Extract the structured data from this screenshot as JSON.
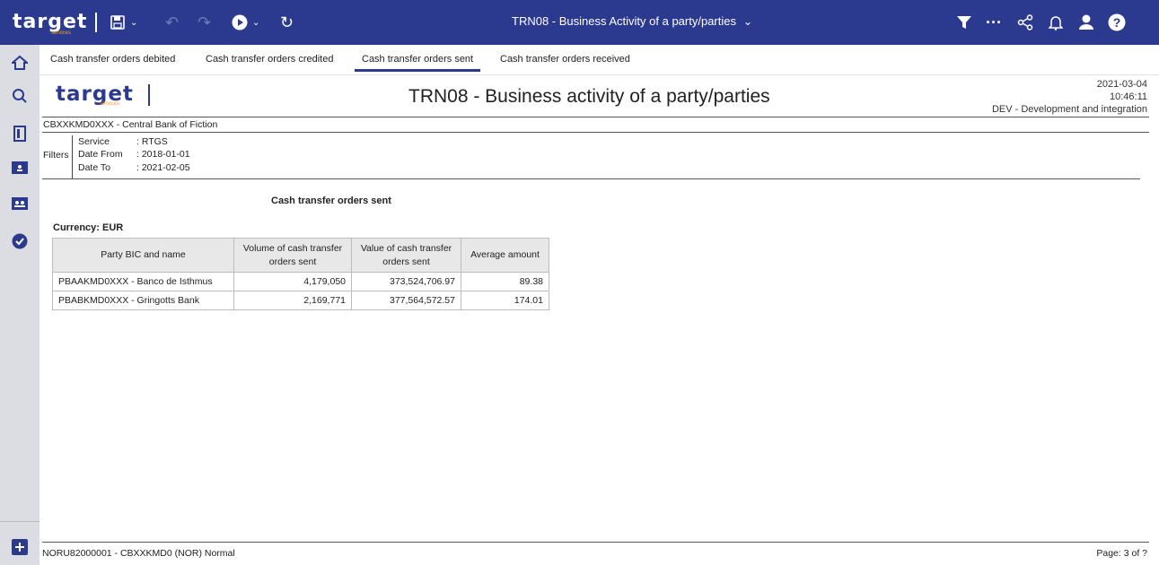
{
  "app": {
    "logo_text": "target",
    "logo_sub": "services",
    "report_title_bar": "TRN08 - Business Activity of a party/parties"
  },
  "tabs": [
    {
      "label": "Cash transfer orders debited"
    },
    {
      "label": "Cash transfer orders credited"
    },
    {
      "label": "Cash transfer orders sent",
      "active": true
    },
    {
      "label": "Cash transfer orders received"
    }
  ],
  "report": {
    "logo_text": "target",
    "logo_sub": "services",
    "title": "TRN08 - Business activity of a party/parties",
    "date": "2021-03-04",
    "time": "10:46:11",
    "environment": "DEV - Development and integration",
    "party": "CBXXKMD0XXX - Central Bank of Fiction",
    "filters_label": "Filters",
    "filters": [
      {
        "key": "Service",
        "value": ": RTGS"
      },
      {
        "key": "Date From",
        "value": ": 2018-01-01"
      },
      {
        "key": "Date To",
        "value": ": 2021-02-05"
      }
    ],
    "section_title": "Cash transfer orders sent",
    "currency": "Currency:  EUR",
    "table": {
      "headers": [
        "Party BIC and name",
        "Volume of cash transfer orders sent",
        "Value of cash transfer orders sent",
        "Average amount"
      ],
      "rows": [
        [
          "PBAAKMD0XXX - Banco de Isthmus",
          "4,179,050",
          "373,524,706.97",
          "89.38"
        ],
        [
          "PBABKMD0XXX - Gringotts Bank",
          "2,169,771",
          "377,564,572.57",
          "174.01"
        ]
      ]
    },
    "footer_left": "NORU82000001 - CBXXKMD0 (NOR) Normal",
    "footer_right": "Page: 3 of ?"
  },
  "colors": {
    "brand": "#2b3a8f",
    "accent": "#f0a030",
    "rail": "#dcdde3"
  },
  "icons": [
    "save-icon",
    "undo-icon",
    "redo-icon",
    "run-icon",
    "refresh-icon",
    "filter-icon",
    "more-icon",
    "share-icon",
    "bell-icon",
    "user-icon",
    "help-icon",
    "home-icon",
    "search-icon",
    "library-icon",
    "folder-icon",
    "team-folder-icon",
    "check-icon",
    "add-icon"
  ]
}
